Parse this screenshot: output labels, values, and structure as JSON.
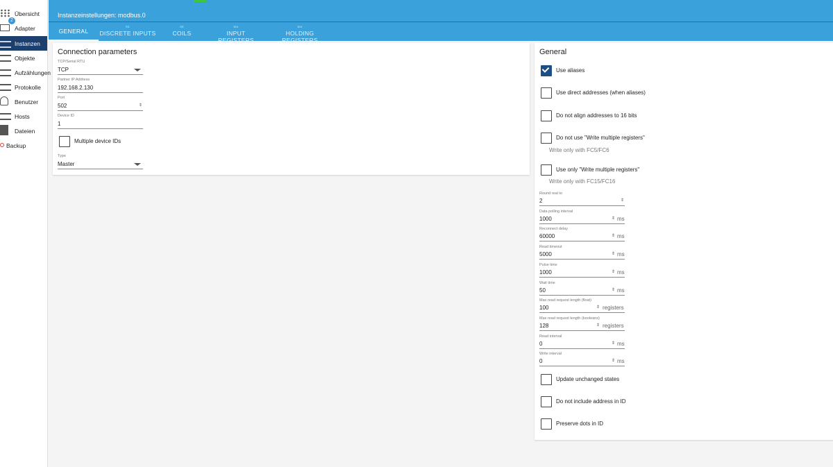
{
  "header": {
    "title": "Instanzeinstellungen: modbus.0"
  },
  "sidebar": {
    "items": [
      {
        "label": "Übersicht",
        "icon": "grid-icon"
      },
      {
        "label": "Adapter",
        "icon": "store-icon",
        "badge": "2"
      },
      {
        "label": "Instanzen",
        "icon": "instances-icon"
      },
      {
        "label": "Objekte",
        "icon": "list-icon"
      },
      {
        "label": "Aufzählungen",
        "icon": "enum-icon"
      },
      {
        "label": "Protokolle",
        "icon": "log-icon"
      },
      {
        "label": "Benutzer",
        "icon": "user-icon"
      },
      {
        "label": "Hosts",
        "icon": "server-icon"
      },
      {
        "label": "Dateien",
        "icon": "file-icon"
      },
      {
        "label": "Backup",
        "icon": "backup-icon"
      }
    ]
  },
  "tabs": [
    {
      "label": "GENERAL",
      "sub": ""
    },
    {
      "label": "DISCRETE INPUTS",
      "sub": "01"
    },
    {
      "label": "COILS",
      "sub": "02"
    },
    {
      "label": "INPUT REGISTERS",
      "sub": "tex"
    },
    {
      "label": "HOLDING REGISTERS",
      "sub": "tex"
    }
  ],
  "connection": {
    "title": "Connection parameters",
    "tcp_label": "TCP/Serial RTU",
    "tcp_value": "TCP",
    "ip_label": "Partner IP Address",
    "ip_value": "192.168.2.130",
    "port_label": "Port",
    "port_value": "502",
    "device_label": "Device ID",
    "device_value": "1",
    "multi_label": "Multiple device IDs",
    "type_label": "Type",
    "type_value": "Master"
  },
  "general": {
    "title": "General",
    "checkboxes": [
      {
        "label": "Use aliases",
        "checked": true
      },
      {
        "label": "Use direct addresses (when aliases)",
        "checked": false
      },
      {
        "label": "Do not align addresses to 16 bits",
        "checked": false
      },
      {
        "label": "Do not use \"Write multiple registers\"",
        "checked": false,
        "helper": "Write only with FC5/FC6"
      },
      {
        "label": "Use only \"Write multiple registers\"",
        "checked": false,
        "helper": "Write only with FC15/FC16"
      }
    ],
    "fields": [
      {
        "label": "Round real to",
        "value": "2",
        "unit": ""
      },
      {
        "label": "Data polling interval",
        "value": "1000",
        "unit": "ms"
      },
      {
        "label": "Reconnect delay",
        "value": "60000",
        "unit": "ms"
      },
      {
        "label": "Read timeout",
        "value": "5000",
        "unit": "ms"
      },
      {
        "label": "Pulse time",
        "value": "1000",
        "unit": "ms"
      },
      {
        "label": "Wait time",
        "value": "50",
        "unit": "ms"
      },
      {
        "label": "Max read request length (float)",
        "value": "100",
        "unit": "registers"
      },
      {
        "label": "Max read request length (booleans)",
        "value": "128",
        "unit": "registers"
      },
      {
        "label": "Read interval",
        "value": "0",
        "unit": "ms"
      },
      {
        "label": "Write interval",
        "value": "0",
        "unit": "ms"
      }
    ],
    "bottom_checkboxes": [
      {
        "label": "Update unchanged states",
        "checked": false
      },
      {
        "label": "Do not include address in ID",
        "checked": false
      },
      {
        "label": "Preserve dots in ID",
        "checked": false
      }
    ]
  }
}
